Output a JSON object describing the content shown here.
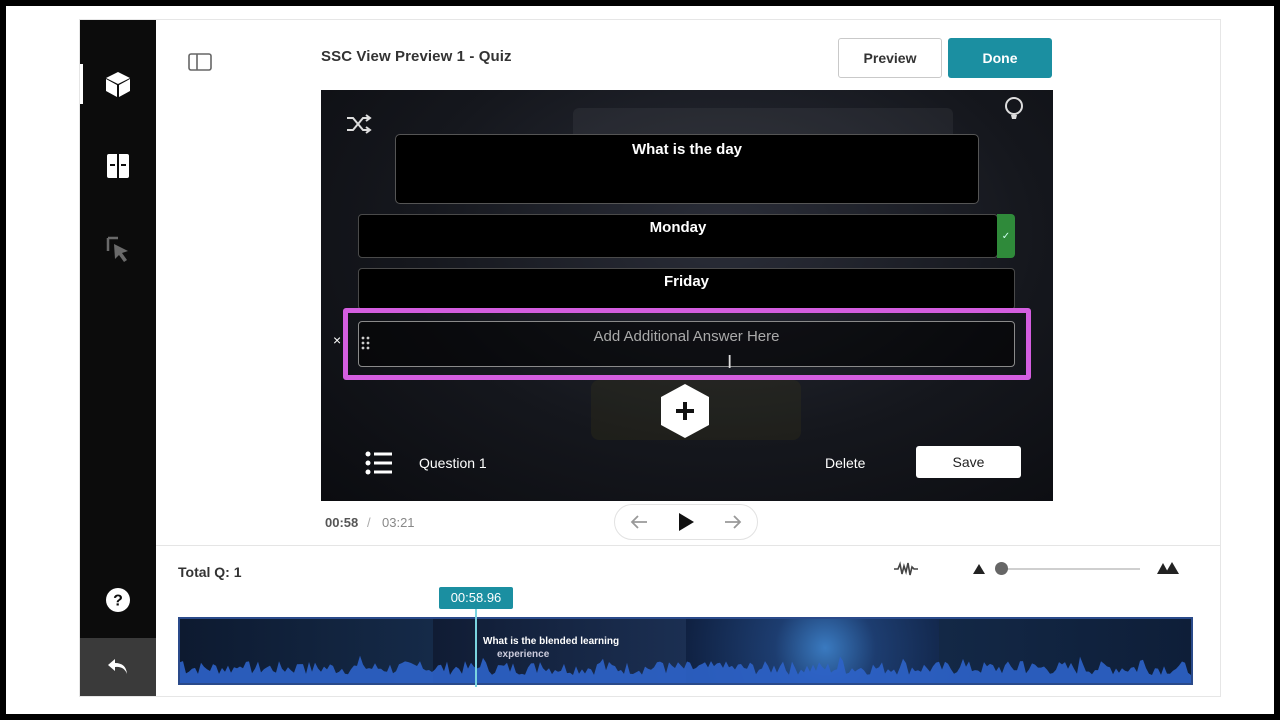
{
  "header": {
    "title": "SSC View Preview 1 - Quiz",
    "preview_label": "Preview",
    "done_label": "Done"
  },
  "sidebar": {
    "items": [
      {
        "icon": "cube-icon"
      },
      {
        "icon": "book-icon"
      },
      {
        "icon": "cursor-click-icon"
      }
    ],
    "help_icon": "help-icon",
    "back_icon": "undo-icon"
  },
  "quiz": {
    "question_text": "What is the day",
    "answers": [
      {
        "text": "Monday",
        "correct": true
      },
      {
        "text": "Friday",
        "correct": false
      }
    ],
    "add_answer_placeholder": "Add Additional Answer Here",
    "question_label": "Question 1",
    "delete_label": "Delete",
    "save_label": "Save",
    "remove_symbol": "×",
    "check_symbol": "✓"
  },
  "player": {
    "current_time": "00:58",
    "separator": "/",
    "total_time": "03:21"
  },
  "timeline": {
    "total_questions": "Total Q: 1",
    "playhead_time": "00:58.96",
    "thumb_caption_line1": "What is the blended learning",
    "thumb_caption_line2": "experience"
  },
  "colors": {
    "accent": "#1b8fa1",
    "highlight": "#d45ee0",
    "correct": "#2f8a3a"
  }
}
